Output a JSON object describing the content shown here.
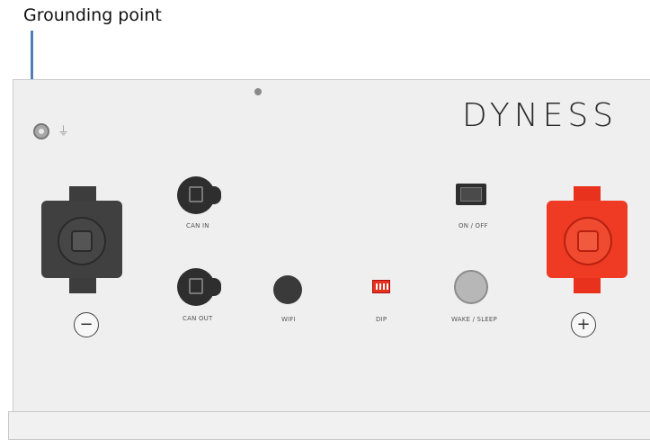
{
  "callout": {
    "label": "Grounding point"
  },
  "brand": "DYNESS",
  "panel": {
    "ground_symbol": "⏚",
    "negative_sign": "−",
    "positive_sign": "+",
    "ports": [
      {
        "id": "can-in",
        "label": "CAN IN"
      },
      {
        "id": "can-out",
        "label": "CAN OUT"
      },
      {
        "id": "wifi",
        "label": "WIFI"
      },
      {
        "id": "dip",
        "label": "DIP"
      },
      {
        "id": "wake-sleep",
        "label": "WAKE / SLEEP"
      },
      {
        "id": "power-switch",
        "label": "ON / OFF"
      }
    ]
  },
  "colors": {
    "positive_terminal": "#ef3b23",
    "negative_terminal": "#404040",
    "callout_line": "#4f7fb4"
  }
}
